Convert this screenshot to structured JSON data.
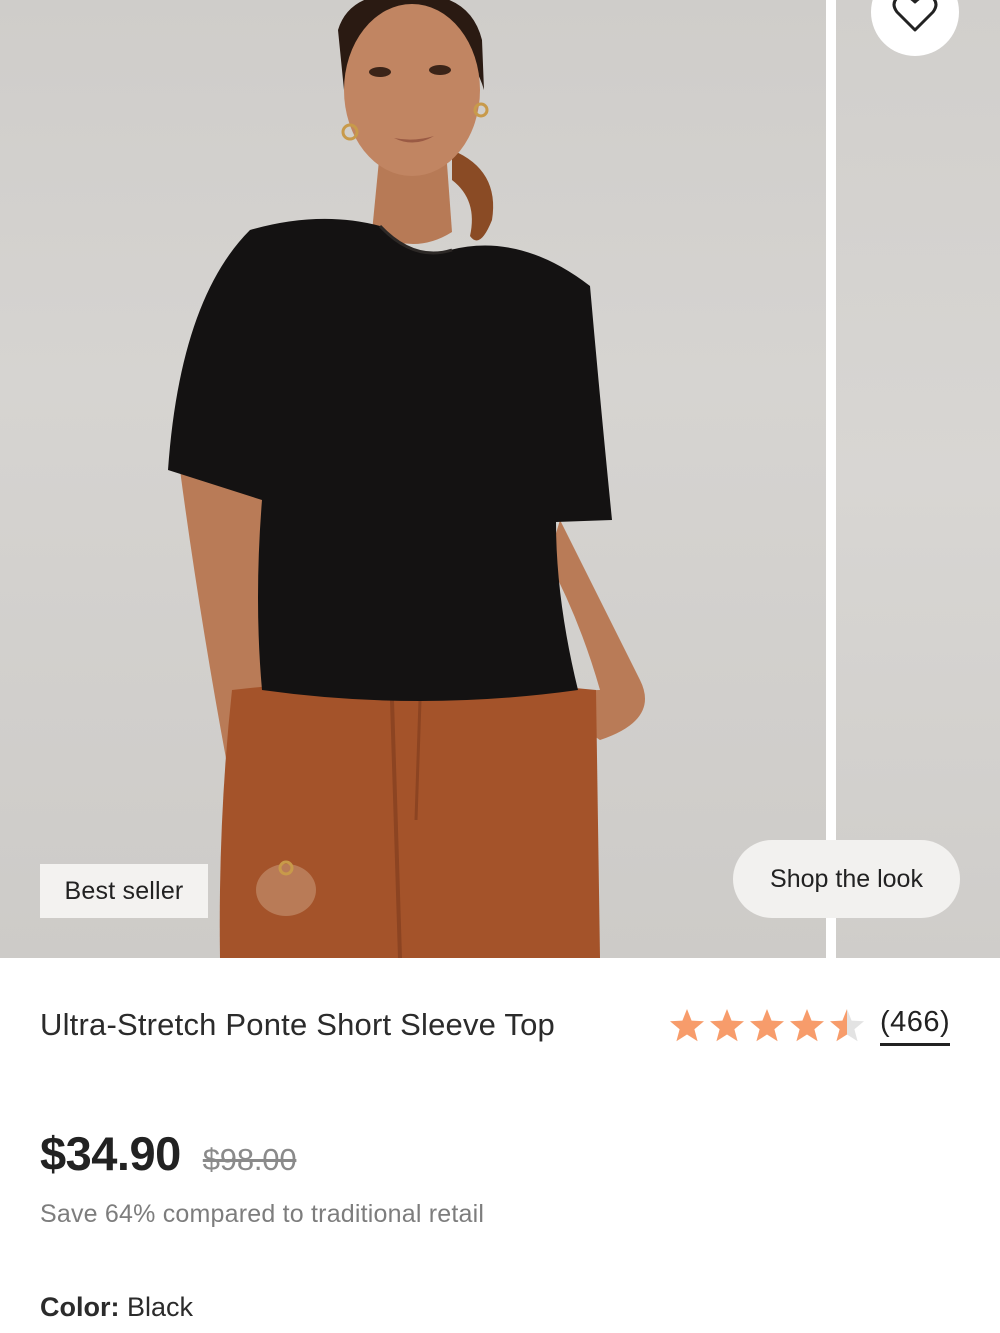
{
  "gallery": {
    "badge": "Best seller",
    "shop_the_look": "Shop the look",
    "favorite_icon": "heart-icon"
  },
  "product": {
    "title": "Ultra-Stretch Ponte Short Sleeve Top",
    "rating": {
      "value": 4.5,
      "max": 5,
      "review_count": "(466)",
      "star_color": "#f79c6b",
      "empty_star_color": "#e3e3e3"
    },
    "price": "$34.90",
    "compare_price": "$98.00",
    "savings_text": "Save 64% compared to traditional retail",
    "color_label": "Color:",
    "color_value": "Black"
  }
}
